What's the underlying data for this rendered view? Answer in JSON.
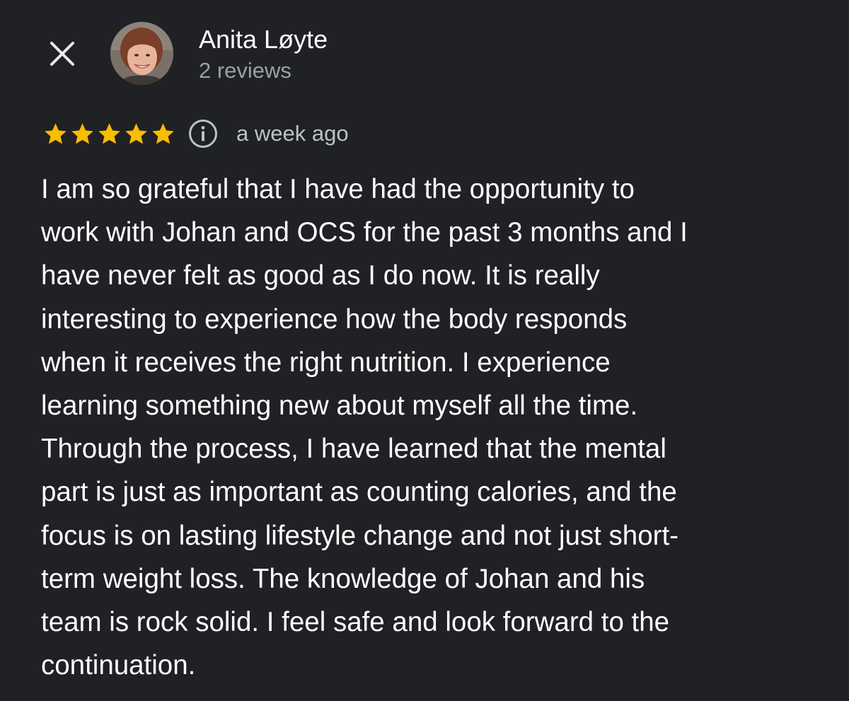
{
  "header": {
    "close_icon": "close-icon",
    "author_name": "Anita Løyte",
    "author_reviews": "2 reviews"
  },
  "rating": {
    "stars": 5,
    "max_stars": 5,
    "star_color": "#fbbc04",
    "info_icon": "info-icon",
    "date": "a week ago"
  },
  "review": {
    "lines": [
      "I am so grateful that I have had the opportunity to",
      "work with Johan and OCS for the past 3 months and I",
      "have never felt as good as I do now. It is really",
      "interesting to experience how the body responds",
      "when it receives the right nutrition. I experience",
      "learning something new about myself all the time.",
      "Through the process, I have learned that the mental",
      "part is just as important as counting calories, and the",
      "focus is on lasting lifestyle change and not just short-",
      "term weight loss. The knowledge of Johan and his",
      "team is rock solid. I feel safe and look forward to the",
      "continuation."
    ]
  },
  "colors": {
    "background": "#202124",
    "text_primary": "#ffffff",
    "text_secondary": "#9aa0a6"
  }
}
